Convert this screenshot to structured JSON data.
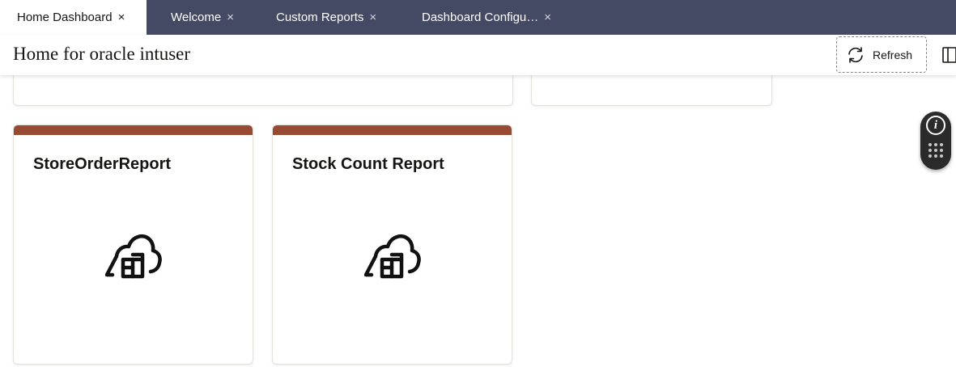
{
  "tabs": [
    {
      "label": "Home Dashboard",
      "active": true
    },
    {
      "label": "Welcome",
      "active": false
    },
    {
      "label": "Custom Reports",
      "active": false
    },
    {
      "label": "Dashboard Configu…",
      "active": false
    }
  ],
  "tab_close_glyph": "×",
  "header": {
    "title": "Home for oracle intuser",
    "refresh_label": "Refresh"
  },
  "cards": [
    {
      "title": "StoreOrderReport",
      "icon": "cloud-chart-icon"
    },
    {
      "title": "Stock Count Report",
      "icon": "cloud-chart-icon"
    }
  ],
  "widget": {
    "info_glyph": "i"
  },
  "colors": {
    "tab_bar": "#454a64",
    "card_accent": "#964b32",
    "widget_bg": "#2b2b2b"
  }
}
